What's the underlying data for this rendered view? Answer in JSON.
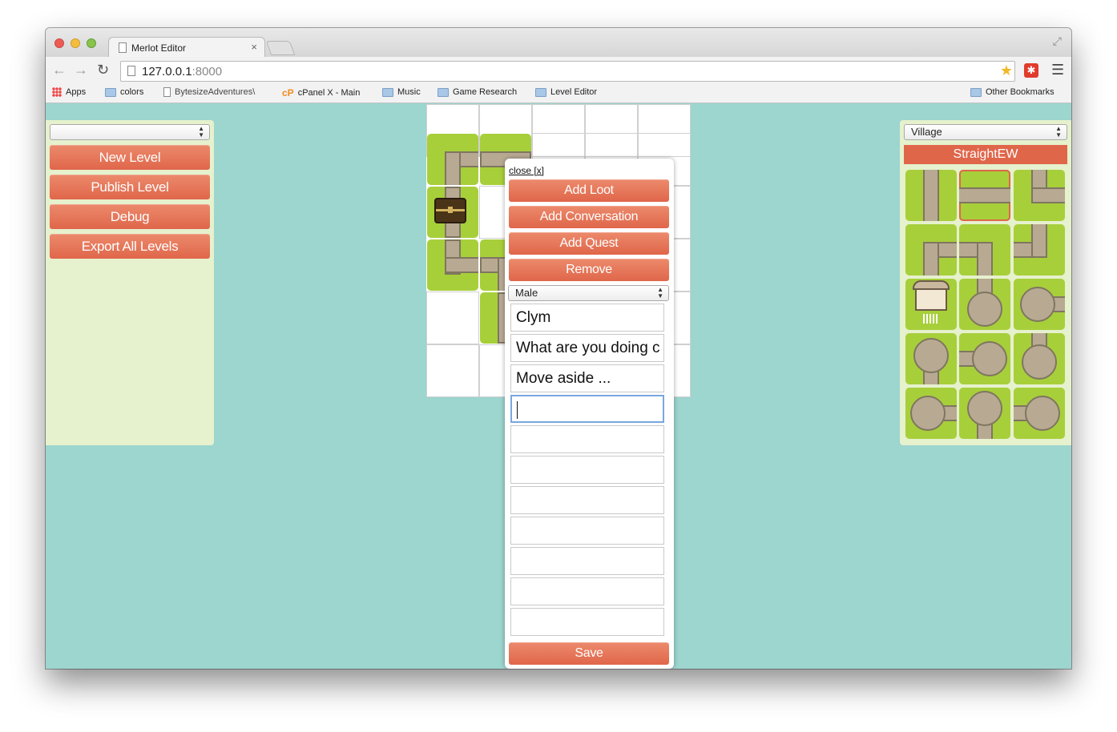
{
  "browser": {
    "tab_title": "Merlot Editor",
    "tab_close": "×",
    "url_host": "127.0.0.1",
    "url_port": ":8000",
    "bookmarks": [
      {
        "label": "Apps",
        "icon": "apps-icon"
      },
      {
        "label": "colors",
        "icon": "folder-icon"
      },
      {
        "label": "BytesizeAdventures\\",
        "icon": "page-icon"
      },
      {
        "label": "cPanel X - Main",
        "icon": "cpanel-icon"
      },
      {
        "label": "Music",
        "icon": "folder-icon"
      },
      {
        "label": "Game Research",
        "icon": "folder-icon"
      },
      {
        "label": "Level Editor",
        "icon": "folder-icon"
      }
    ],
    "other_bookmarks": "Other Bookmarks"
  },
  "left_panel": {
    "level_select_value": "",
    "buttons": {
      "new_level": "New Level",
      "publish_level": "Publish Level",
      "debug": "Debug",
      "export_all": "Export All Levels"
    }
  },
  "popup": {
    "close_label": "close [x]",
    "buttons": {
      "add_loot": "Add Loot",
      "add_conversation": "Add Conversation",
      "add_quest": "Add Quest",
      "remove": "Remove",
      "save": "Save"
    },
    "gender_select": "Male",
    "fields": [
      "Clym",
      "What are you doing c",
      "Move aside ...",
      "",
      "",
      "",
      "",
      "",
      "",
      "",
      ""
    ]
  },
  "right_panel": {
    "tileset_select": "Village",
    "selected_tile_label": "StraightEW"
  },
  "colors": {
    "accent": "#e0664a",
    "page_bg": "#9dd5cf",
    "panel_bg": "#e6f1cd",
    "grass": "#a7cf3a",
    "road": "#b8a993"
  }
}
